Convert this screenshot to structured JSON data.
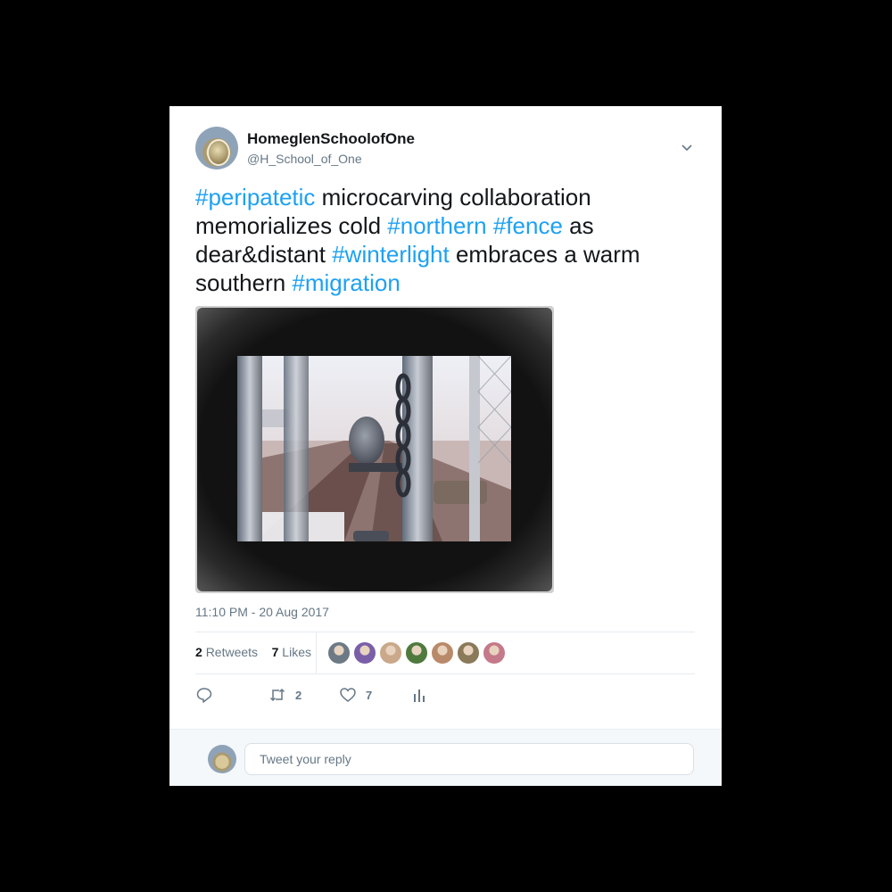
{
  "tweet": {
    "author": {
      "name": "HomeglenSchoolofOne",
      "handle": "@H_School_of_One"
    },
    "text_segments": [
      {
        "text": "#peripatetic",
        "hashtag": true
      },
      {
        "text": " microcarving collaboration memorializes cold ",
        "hashtag": false
      },
      {
        "text": "#northern",
        "hashtag": true
      },
      {
        "text": " ",
        "hashtag": false
      },
      {
        "text": "#fence",
        "hashtag": true
      },
      {
        "text": " as dear&distant ",
        "hashtag": false
      },
      {
        "text": "#winterlight",
        "hashtag": true
      },
      {
        "text": " embraces a warm southern ",
        "hashtag": false
      },
      {
        "text": "#migration",
        "hashtag": true
      }
    ],
    "timestamp": "11:10 PM - 20 Aug 2017",
    "stats": {
      "retweets_count": "2",
      "retweets_label": "Retweets",
      "likes_count": "7",
      "likes_label": "Likes"
    },
    "likers": [
      {
        "color": "#6d7a86"
      },
      {
        "color": "#7a5fa8"
      },
      {
        "color": "#c9a98a"
      },
      {
        "color": "#4f7a3e"
      },
      {
        "color": "#b98a6a"
      },
      {
        "color": "#8a7a5a"
      },
      {
        "color": "#c47a8a"
      }
    ],
    "actions": {
      "retweet_count": "2",
      "like_count": "7"
    }
  },
  "reply": {
    "placeholder": "Tweet your reply"
  },
  "colors": {
    "accent": "#1da1f2",
    "secondary_text": "#657786",
    "divider": "#e6ecf0"
  },
  "icons": [
    "chevron-down-icon",
    "reply-icon",
    "retweet-icon",
    "heart-icon",
    "analytics-icon"
  ]
}
